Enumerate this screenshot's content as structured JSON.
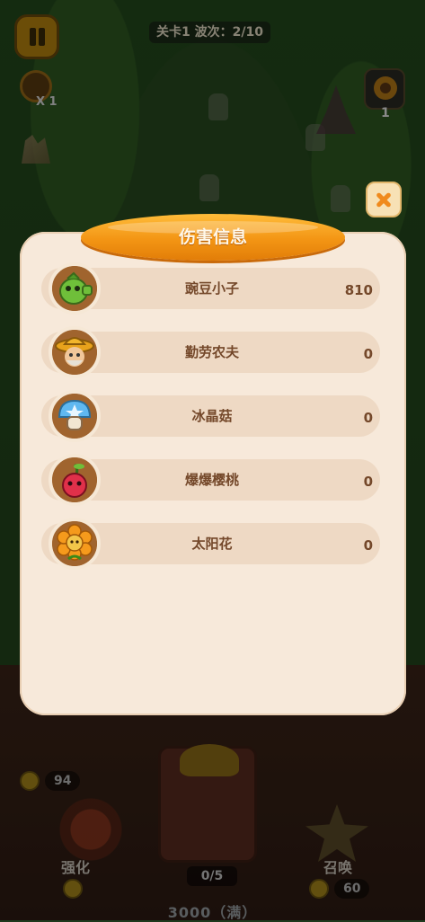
{
  "hud": {
    "level_info": "关卡1 波次：2/10",
    "speed_label": "X 1",
    "sunflower_count": "1"
  },
  "popup": {
    "title": "伤害信息",
    "entries": [
      {
        "name": "豌豆小子",
        "value": "810",
        "icon": "pea-shooter-icon"
      },
      {
        "name": "勤劳农夫",
        "value": "0",
        "icon": "farmer-icon"
      },
      {
        "name": "冰晶菇",
        "value": "0",
        "icon": "ice-mushroom-icon"
      },
      {
        "name": "爆爆樱桃",
        "value": "0",
        "icon": "cherry-bomb-icon"
      },
      {
        "name": "太阳花",
        "value": "0",
        "icon": "sunflower-icon"
      }
    ]
  },
  "bottom": {
    "left_coins": "94",
    "strength_label": "强化",
    "wave_progress": "0/5",
    "summon_label": "召唤",
    "summon_cost": "60",
    "capacity": "3000（满）"
  },
  "colors": {
    "panel_bg": "#f7e9da",
    "row_bg": "#eed9c4",
    "title_orange": "#f39514",
    "text_brown": "#74482a"
  }
}
